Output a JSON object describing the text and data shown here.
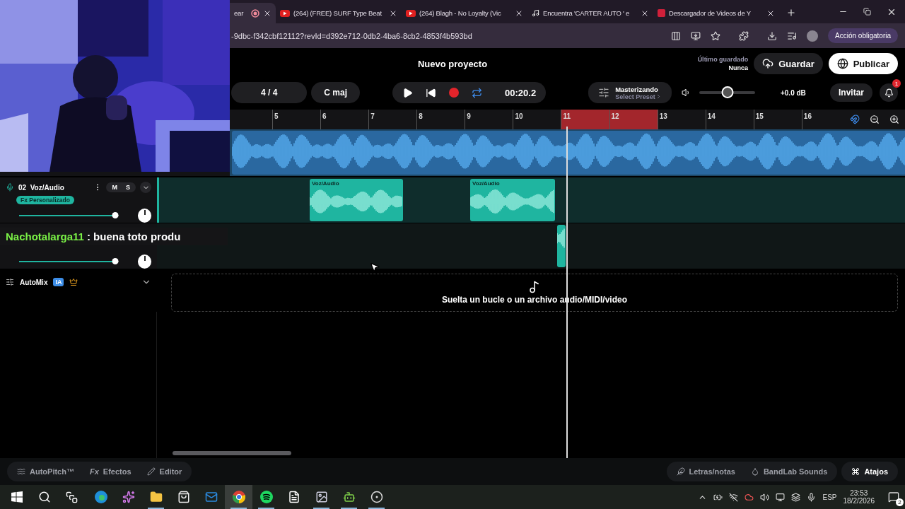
{
  "browser": {
    "tabs": [
      {
        "title": "ear",
        "kind": "plain",
        "selected": true,
        "recording": true
      },
      {
        "title": "(264) (FREE) SURF Type Beat",
        "kind": "video",
        "selected": false,
        "recording": false
      },
      {
        "title": "(264) Blagh - No Loyalty (Vic",
        "kind": "video",
        "selected": false,
        "recording": false
      },
      {
        "title": "Encuentra 'CARTER AUTO ' e",
        "kind": "note",
        "selected": false,
        "recording": false
      },
      {
        "title": "Descargador de Videos de Y",
        "kind": "square",
        "selected": false,
        "recording": false
      }
    ],
    "url": "-9dbc-f342cbf12112?revId=d392e712-0db2-4ba6-8cb2-4853f4b593bd",
    "action_button": "Acción obligatoria"
  },
  "project": {
    "title": "Nuevo proyecto",
    "last_saved_label": "Último guardado",
    "last_saved_value": "Nunca",
    "save": "Guardar",
    "publish": "Publicar"
  },
  "toolbar": {
    "time_signature": "4 / 4",
    "key": "C maj",
    "loop_on": true,
    "time": "00:20.2",
    "mastering": {
      "title": "Masterizando",
      "preset": "Select Preset"
    },
    "master_volume": {
      "level": 0.5
    },
    "gain": "+0.0 dB",
    "invite": "Invitar",
    "notifications": "1"
  },
  "ruler": {
    "bars": [
      {
        "label": "5",
        "in_loop": false
      },
      {
        "label": "6",
        "in_loop": false
      },
      {
        "label": "7",
        "in_loop": false
      },
      {
        "label": "8",
        "in_loop": false
      },
      {
        "label": "9",
        "in_loop": false
      },
      {
        "label": "10",
        "in_loop": false
      },
      {
        "label": "11",
        "in_loop": true
      },
      {
        "label": "12",
        "in_loop": true
      },
      {
        "label": "13",
        "in_loop": false
      },
      {
        "label": "14",
        "in_loop": false
      },
      {
        "label": "15",
        "in_loop": false
      },
      {
        "label": "16",
        "in_loop": false
      }
    ]
  },
  "tracks": [
    {
      "kind": "hidden",
      "selected": false,
      "color": "#2a68a0",
      "clips": [
        {
          "kind": "audio"
        }
      ]
    },
    {
      "kind": "full",
      "selected": true,
      "color": "#1fb5a0",
      "number": "02",
      "name": "Voz/Audio",
      "mute": "M",
      "solo": "S",
      "fx": "Fx Personalizado",
      "volume": {
        "level": 0.97
      },
      "clips": [
        {
          "kind": "audio",
          "label": "Voz/Audio"
        },
        {
          "kind": "audio",
          "label": "Voz/Audio"
        }
      ]
    },
    {
      "kind": "covered",
      "selected": false,
      "color": "#1fb5a0",
      "volume": {
        "level": 0.97
      },
      "clips": [
        {
          "kind": "audio"
        }
      ]
    }
  ],
  "automix": {
    "label": "AutoMix",
    "badge": "IA"
  },
  "dropzone": {
    "text": "Suelta un bucle o un archivo audio/MIDI/video"
  },
  "chat": {
    "user": "Nachotalarga11",
    "message": ": buena toto produ"
  },
  "bottom_bar": {
    "left": [
      {
        "kind": "pitch",
        "label": "AutoPitch™"
      },
      {
        "kind": "fx",
        "glyph": "Fx",
        "label": "Efectos"
      },
      {
        "kind": "pencil",
        "label": "Editor"
      }
    ],
    "right": [
      {
        "kind": "feather",
        "label": "Letras/notas"
      },
      {
        "kind": "sounds",
        "label": "BandLab Sounds"
      }
    ],
    "shortcuts": "Atajos"
  },
  "taskbar": {
    "apps": [
      {
        "kind": "start",
        "selected": false,
        "running": false
      },
      {
        "kind": "search",
        "selected": false,
        "running": false
      },
      {
        "kind": "taskview",
        "selected": false,
        "running": false
      },
      {
        "kind": "edge",
        "selected": false,
        "running": false
      },
      {
        "kind": "copilot",
        "selected": false,
        "running": false
      },
      {
        "kind": "files",
        "selected": false,
        "running": true
      },
      {
        "kind": "store",
        "selected": false,
        "running": false
      },
      {
        "kind": "mail",
        "selected": false,
        "running": false
      },
      {
        "kind": "chrome",
        "selected": true,
        "running": true
      },
      {
        "kind": "spotify",
        "selected": false,
        "running": true
      },
      {
        "kind": "notepad",
        "selected": false,
        "running": false
      },
      {
        "kind": "photos",
        "selected": false,
        "running": true
      },
      {
        "kind": "android",
        "selected": false,
        "running": true
      },
      {
        "kind": "obs",
        "selected": false,
        "running": true
      }
    ],
    "language": "ESP",
    "time": "23:53",
    "date": "18/2/2026",
    "notifications": "2"
  }
}
